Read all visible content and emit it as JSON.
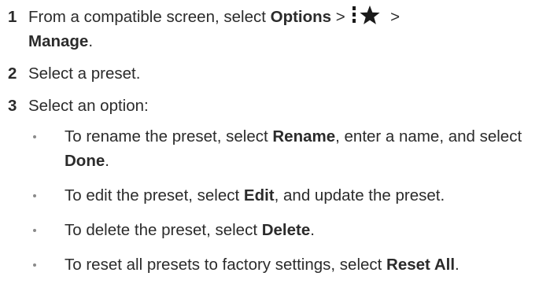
{
  "steps": [
    {
      "number": "1",
      "parts": {
        "pre": "From a compatible screen, select ",
        "options": "Options",
        "sep1": " > ",
        "sep2": " > ",
        "manage": "Manage",
        "end": "."
      },
      "icons": [
        "more-menu-icon",
        "star-icon"
      ]
    },
    {
      "number": "2",
      "text": "Select a preset."
    },
    {
      "number": "3",
      "text": "Select an option:",
      "bullets": [
        {
          "pre": "To rename the preset, select ",
          "kw1": "Rename",
          "mid": ", enter a name, and select ",
          "kw2": "Done",
          "end": "."
        },
        {
          "pre": "To edit the preset, select ",
          "kw1": "Edit",
          "end": ", and update the preset."
        },
        {
          "pre": "To delete the preset, select ",
          "kw1": "Delete",
          "end": "."
        },
        {
          "pre": "To reset all presets to factory settings, select ",
          "kw1": "Reset All",
          "end": "."
        }
      ]
    }
  ],
  "colors": {
    "text": "#2b2b2b",
    "bullet": "#8a8a8a",
    "icon": "#1a1a1a"
  }
}
